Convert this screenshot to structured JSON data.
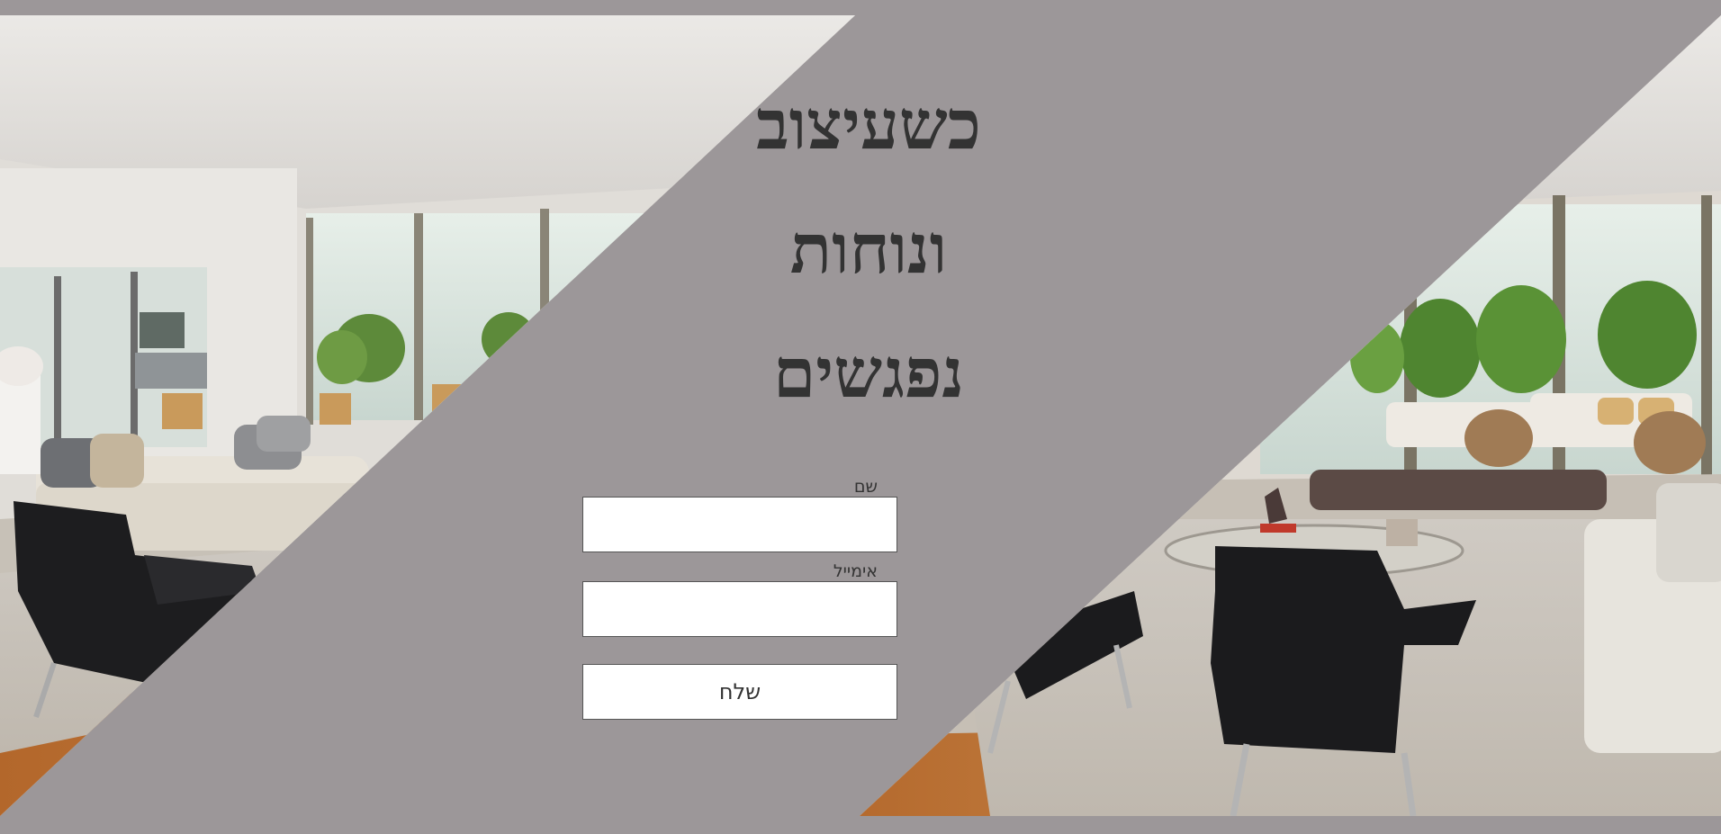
{
  "hero": {
    "headline": "כשעיצוב\nונוחות\nנפגשים"
  },
  "form": {
    "name_label": "שם",
    "name_value": "",
    "email_label": "אימייל",
    "email_value": "",
    "submit_label": "שלח"
  },
  "colors": {
    "background": "#9c9799",
    "headline": "#333333",
    "field": "#ffffff"
  },
  "images": {
    "left_photo": "living-room-photo",
    "right_photo": "living-room-photo"
  }
}
